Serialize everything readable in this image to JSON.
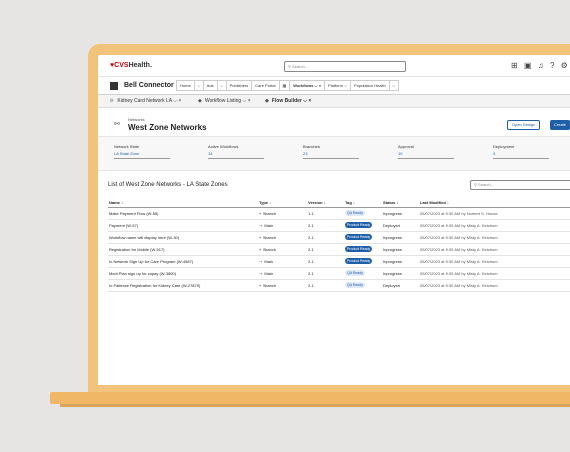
{
  "topbar": {
    "logo_brand": "CVS",
    "logo_suffix": "Health.",
    "search_placeholder": "Search...",
    "icons": [
      "grid-icon",
      "notification-icon",
      "bell-icon",
      "help-icon",
      "settings-icon"
    ]
  },
  "nav": {
    "app_name": "Bell Connector",
    "tabs": [
      "Home",
      "Ads",
      "Publishers",
      "Care Portal",
      "Workflows",
      "Platform",
      "Population Health"
    ]
  },
  "workspace_tabs": [
    "Kidney Card Network LA",
    "Workflow Listing",
    "Flow Builder"
  ],
  "header": {
    "subtitle": "Networks",
    "title": "West Zone Networks",
    "open_design": "Open Design",
    "create": "Create"
  },
  "details": [
    {
      "label": "Network State",
      "value": "LA State Zone"
    },
    {
      "label": "Active Workflows",
      "value": "14"
    },
    {
      "label": "Branches",
      "value": "23"
    },
    {
      "label": "Approval",
      "value": "10"
    },
    {
      "label": "Deployment",
      "value": "3"
    }
  ],
  "list": {
    "title": "List of West Zone Networks - LA State Zones",
    "search_placeholder": "Search...",
    "columns": [
      "Name ↓",
      "Type ↓",
      "Version ↓",
      "Tag ↓",
      "Status ↓",
      "Last Modified ↓"
    ],
    "rows": [
      {
        "name": "Make Payment Flow (W-56)",
        "type": "Branch",
        "version": "1.1",
        "tag": "QA Ready",
        "status": "Inprogress",
        "modified": "05/07/2023 at 9:30 AM by Norbert S. House"
      },
      {
        "name": "Payment (W-57)",
        "type": "Main",
        "version": "2.1",
        "tag": "Product Ready",
        "status": "Deployed",
        "modified": "05/07/2023 at 9:30 AM by Misty A. Ketchum"
      },
      {
        "name": "Workflow name will display here (W-30)",
        "type": "Branch",
        "version": "2.1",
        "tag": "Product Ready",
        "status": "Inprogress",
        "modified": "05/07/2023 at 9:30 AM by Misty A. Ketchum"
      },
      {
        "name": "Registration for Mobile (W-517)",
        "type": "Branch",
        "version": "2.1",
        "tag": "Product Ready",
        "status": "Inprogress",
        "modified": "05/07/2023 at 9:30 AM by Misty A. Ketchum"
      },
      {
        "name": "In Network Sign Up for Care Program (W-4587)",
        "type": "Main",
        "version": "2.1",
        "tag": "Product Ready",
        "status": "Inprogress",
        "modified": "05/07/2023 at 9:30 AM by Misty A. Ketchum"
      },
      {
        "name": "Medi Plan sign up for copay (W-3890)",
        "type": "Main",
        "version": "2.1",
        "tag": "QA Ready",
        "status": "Inprogress",
        "modified": "05/07/2023 at 9:30 AM by Misty A. Ketchum"
      },
      {
        "name": "In Patience Registration for Kidney Care (W-27879)",
        "type": "Branch",
        "version": "2.1",
        "tag": "QA Ready",
        "status": "Deployed",
        "modified": "05/07/2023 at 9:30 AM by Misty A. Ketchum"
      }
    ]
  },
  "colors": {
    "accent": "#1f5fa8",
    "brand": "#cc0000",
    "laptop": "#f2c37a"
  }
}
